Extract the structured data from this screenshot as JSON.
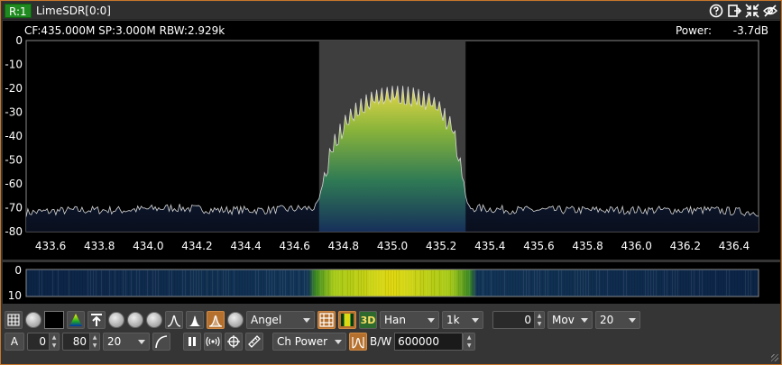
{
  "window": {
    "index_badge": "R:1",
    "title": "LimeSDR[0:0]",
    "icons": [
      "help-icon",
      "move-icon",
      "shrink-icon",
      "hide-icon"
    ]
  },
  "status": {
    "left": "CF:435.000M SP:3.000M RBW:2.929k",
    "power_label": "Power:",
    "power_value": "-3.7dB"
  },
  "chart_data": {
    "type": "area",
    "ylim": [
      -80,
      0
    ],
    "yticks": [
      "0",
      "-10",
      "-20",
      "-30",
      "-40",
      "-50",
      "-60",
      "-70",
      "-80"
    ],
    "xlim": [
      433.5,
      436.5
    ],
    "xticks": [
      "433.6",
      "433.8",
      "434.0",
      "434.2",
      "434.4",
      "434.6",
      "434.8",
      "435.0",
      "435.2",
      "435.4",
      "435.6",
      "435.8",
      "436.0",
      "436.2",
      "436.4"
    ],
    "channel_band": [
      434.7,
      435.3
    ],
    "noise_floor": -72,
    "signal_peak": -20,
    "signal_center": 435.0,
    "series": [
      {
        "x": [
          433.5,
          433.7,
          433.9,
          434.1,
          434.3,
          434.5,
          434.69,
          434.72,
          434.75,
          434.8,
          434.85,
          434.9,
          434.95,
          435.0,
          435.05,
          435.1,
          435.15,
          435.2,
          435.25,
          435.28,
          435.31,
          435.5,
          435.7,
          435.9,
          436.1,
          436.3,
          436.5
        ],
        "y": [
          -72,
          -71,
          -71,
          -70,
          -71,
          -71,
          -70,
          -60,
          -46,
          -36,
          -30,
          -26,
          -24,
          -23,
          -23,
          -24,
          -26,
          -30,
          -38,
          -54,
          -70,
          -71,
          -71,
          -71,
          -71,
          -71,
          -72
        ]
      }
    ],
    "waterfall_yticks": [
      "0",
      "10"
    ]
  },
  "controls_row1": {
    "palette": "Angel",
    "window": "Han",
    "fft_size": "1k",
    "averaging_value": "0",
    "averaging_mode": "Mov",
    "avg_count": "20",
    "btn_3d": "3D"
  },
  "controls_row2": {
    "auto_label": "A",
    "ref_level": "0",
    "range": "80",
    "decay": "20",
    "measure": "Ch Power",
    "bw_label": "B/W",
    "bw_value": "600000"
  }
}
